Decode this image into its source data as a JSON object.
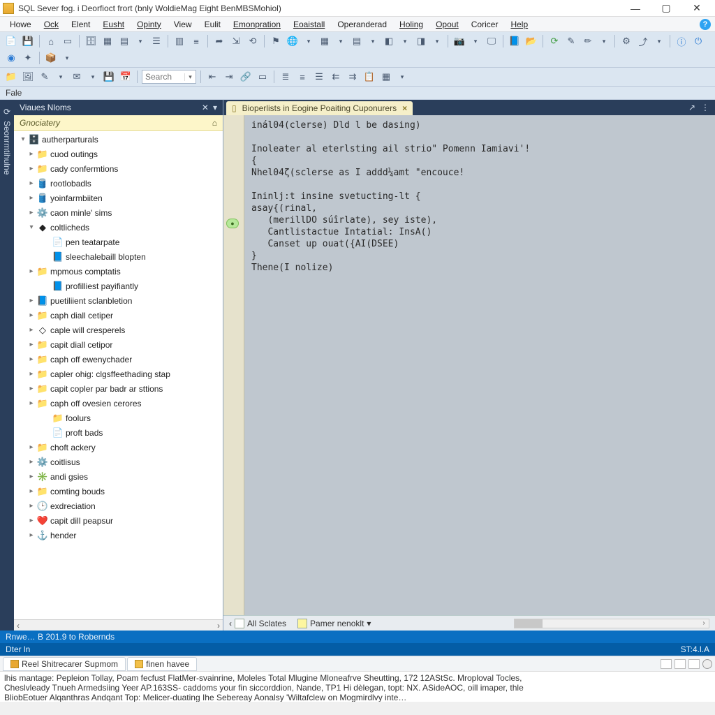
{
  "window": {
    "title": "SQL Sever fog. i Deorfioct frort (bnly WoldieMag Eight BenMBSMohiol)"
  },
  "menubar": {
    "items": [
      {
        "label": "Howe",
        "accel": "H"
      },
      {
        "label": "Ock",
        "accel": "O"
      },
      {
        "label": "Elent",
        "accel": "E"
      },
      {
        "label": "Eusht",
        "accel": "E"
      },
      {
        "label": "Opinty",
        "accel": "O"
      },
      {
        "label": "View",
        "accel": ""
      },
      {
        "label": "Eulit",
        "accel": ""
      },
      {
        "label": "Emonpration",
        "accel": "E"
      },
      {
        "label": "Eoaistall",
        "accel": "E"
      },
      {
        "label": "Operanderad",
        "accel": ""
      },
      {
        "label": "Holing",
        "accel": "H"
      },
      {
        "label": "Opout",
        "accel": "O"
      },
      {
        "label": "Coricer",
        "accel": ""
      },
      {
        "label": "Help",
        "accel": "H"
      }
    ]
  },
  "toolbar1": {
    "search_placeholder": "Search"
  },
  "file_label": "Fale",
  "leftrail": {
    "label": "Seonrmtihulne"
  },
  "sidebar": {
    "title": "Viaues Nloms",
    "filter": "Gnociatery",
    "tree": [
      {
        "depth": 0,
        "arrow": "▾",
        "icon": "server",
        "label": "autherparturals"
      },
      {
        "depth": 1,
        "arrow": "▸",
        "icon": "folder-y",
        "label": "cuod outings"
      },
      {
        "depth": 1,
        "arrow": "▸",
        "icon": "folder-y",
        "label": "cady confermtions"
      },
      {
        "depth": 1,
        "arrow": "▸",
        "icon": "db-red",
        "label": "rootlobadls"
      },
      {
        "depth": 1,
        "arrow": "▸",
        "icon": "db-red",
        "label": "yoinfarmbiiten"
      },
      {
        "depth": 1,
        "arrow": "▸",
        "icon": "gear-y",
        "label": "caon minle' sims"
      },
      {
        "depth": 1,
        "arrow": "▾",
        "icon": "cube",
        "label": "coltlicheds"
      },
      {
        "depth": 2,
        "arrow": "",
        "icon": "page-y",
        "label": "pen teatarpate"
      },
      {
        "depth": 2,
        "arrow": "",
        "icon": "page-b",
        "label": "sleechalebaill blopten"
      },
      {
        "depth": 1,
        "arrow": "▸",
        "icon": "folder",
        "label": "mpmous comptatis"
      },
      {
        "depth": 2,
        "arrow": "",
        "icon": "page-b",
        "label": "profilliest payifiantly"
      },
      {
        "depth": 1,
        "arrow": "▸",
        "icon": "page-b",
        "label": "puetiliient sclanbletion"
      },
      {
        "depth": 1,
        "arrow": "▸",
        "icon": "folder",
        "label": "caph diall cetiper"
      },
      {
        "depth": 1,
        "arrow": "▸",
        "icon": "diamond",
        "label": "caple will cresperels"
      },
      {
        "depth": 1,
        "arrow": "▸",
        "icon": "folder",
        "label": "capit diall cetipor"
      },
      {
        "depth": 1,
        "arrow": "▸",
        "icon": "folder",
        "label": "caph off ewenychader"
      },
      {
        "depth": 1,
        "arrow": "▸",
        "icon": "folder",
        "label": "capler ohig: clgsffeethading stap"
      },
      {
        "depth": 1,
        "arrow": "▸",
        "icon": "folder",
        "label": "capit copler par badr ar sttions"
      },
      {
        "depth": 1,
        "arrow": "▸",
        "icon": "folder",
        "label": "caph off ovesien cerores"
      },
      {
        "depth": 2,
        "arrow": "",
        "icon": "folder",
        "label": "foolurs"
      },
      {
        "depth": 2,
        "arrow": "",
        "icon": "page-y",
        "label": "proft bads"
      },
      {
        "depth": 1,
        "arrow": "▸",
        "icon": "folder",
        "label": "choft ackery"
      },
      {
        "depth": 1,
        "arrow": "▸",
        "icon": "gear",
        "label": "coitlisus"
      },
      {
        "depth": 1,
        "arrow": "▸",
        "icon": "gear-p",
        "label": "andi gsies"
      },
      {
        "depth": 1,
        "arrow": "▸",
        "icon": "folder",
        "label": "comting bouds"
      },
      {
        "depth": 1,
        "arrow": "▸",
        "icon": "clock",
        "label": "exdreciation"
      },
      {
        "depth": 1,
        "arrow": "▸",
        "icon": "heart",
        "label": "capit dill peapsur"
      },
      {
        "depth": 1,
        "arrow": "▸",
        "icon": "anchor",
        "label": "hender"
      }
    ]
  },
  "editor": {
    "tab_title": "Bioperlists in Eogine Poaiting Cuponurers",
    "code_lines": [
      "inál04(clerse) Dld l be dasing)",
      "",
      "Inoleater al eterlsting ail strio\" Pomenn Iamiavi'!",
      "{",
      "Nhel04ζ(sclerse as I addd¼amt \"encouce!",
      "",
      "Ininlj:t insine svetucting-lt {",
      "asay{(rinal,",
      "   (merillDO súîrlate), sey iste),",
      "   Cantlistactue Intatial: InsA()",
      "   Canset up ouat({AI(DSEE)",
      "}",
      "Thene(I nolize)"
    ],
    "marker_line": 9,
    "bottom": {
      "left_label": "All Sclates",
      "right_label": "Pamer nenoklt"
    }
  },
  "status1": "Rnwe…  B 201.9 to Robernds",
  "status2_left": "Dter ln",
  "status2_right": "ST:4.l.A",
  "bottom_tabs": {
    "tab1": "Reel Shitrecarer Supmom",
    "tab2": "finen havee"
  },
  "log": {
    "line1": "lhis mantage: Pepleion Tollay, Poam fecfust FlatMer-svainrine, Moleles Total Mlugine Mloneafrve Sheutting, 172 12AStSc. Mroploval Tocles,",
    "line2": "Cheslvleady Tnueh Armedsiing Yeer AP.163SS- caddoms your fin siccorddion, Nande, TP1 Hi dèlegan, topt: NX. ASideAOC, oill imaper, thle",
    "line3": "BliobEotuer Alqanthras Andqаnt Top: Melicer-duating Ihe Sebereay Aonalsy 'Wiltafclew on Mogmirdlvy inte…"
  }
}
